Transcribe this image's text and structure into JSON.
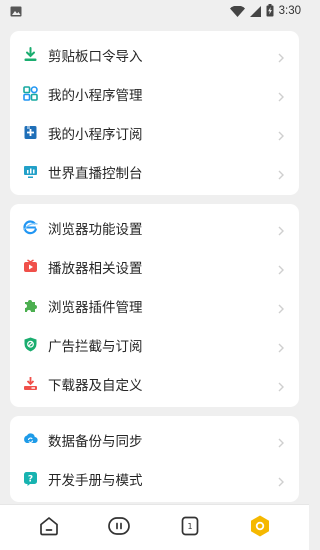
{
  "status_bar": {
    "time": "3:30",
    "icons": [
      "image-icon",
      "wifi-icon",
      "signal-icon",
      "battery-charging-icon"
    ]
  },
  "groups": [
    {
      "items": [
        {
          "label": "剪贴板口令导入",
          "icon": "clipboard-import-icon"
        },
        {
          "label": "我的小程序管理",
          "icon": "mini-program-manage-icon"
        },
        {
          "label": "我的小程序订阅",
          "icon": "mini-program-subscribe-icon"
        },
        {
          "label": "世界直播控制台",
          "icon": "live-console-icon"
        }
      ]
    },
    {
      "items": [
        {
          "label": "浏览器功能设置",
          "icon": "browser-settings-icon"
        },
        {
          "label": "播放器相关设置",
          "icon": "player-settings-icon"
        },
        {
          "label": "浏览器插件管理",
          "icon": "plugin-manage-icon"
        },
        {
          "label": "广告拦截与订阅",
          "icon": "ad-block-icon"
        },
        {
          "label": "下载器及自定义",
          "icon": "downloader-icon"
        }
      ]
    },
    {
      "items": [
        {
          "label": "数据备份与同步",
          "icon": "backup-sync-icon"
        },
        {
          "label": "开发手册与模式",
          "icon": "dev-manual-icon"
        }
      ]
    }
  ],
  "bottom_nav": {
    "items": [
      {
        "icon": "home-icon"
      },
      {
        "icon": "tabs-icon"
      },
      {
        "icon": "page-count-icon",
        "count": "1"
      },
      {
        "icon": "settings-hex-icon",
        "active": true
      }
    ]
  },
  "colors": {
    "accent": "#f5b800",
    "green": "#1aad6f",
    "blue": "#2196f3",
    "red": "#f0504a",
    "teal": "#17a9a0"
  }
}
